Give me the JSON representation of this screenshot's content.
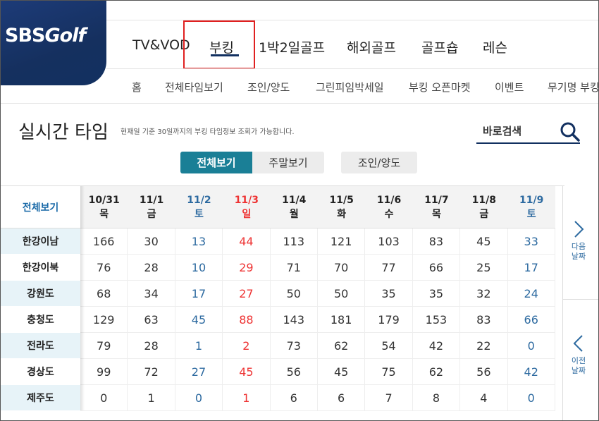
{
  "logo": {
    "sbs": "SBS",
    "golf": "Golf"
  },
  "main_nav": [
    {
      "label": "TV&VOD"
    },
    {
      "label": "부킹"
    },
    {
      "label": "1박2일골프"
    },
    {
      "label": "해외골프"
    },
    {
      "label": "골프숍"
    },
    {
      "label": "레슨"
    }
  ],
  "sub_nav": [
    {
      "label": "홈"
    },
    {
      "label": "전체타임보기"
    },
    {
      "label": "조인/양도"
    },
    {
      "label": "그린피임박세일"
    },
    {
      "label": "부킹 오픈마켓"
    },
    {
      "label": "이벤트"
    },
    {
      "label": "무기명 부킹"
    }
  ],
  "page": {
    "title": "실시간 타임",
    "description": "현재일 기준 30일까지의 부킹 타임정보 조회가 가능합니다."
  },
  "search": {
    "label": "바로검색",
    "icon": "search-icon"
  },
  "tabs": {
    "all": "전체보기",
    "weekend": "주말보기",
    "join": "조인/양도"
  },
  "table": {
    "corner_label": "전체보기",
    "dates": [
      {
        "date": "10/31",
        "day": "목",
        "type": "weekday"
      },
      {
        "date": "11/1",
        "day": "금",
        "type": "weekday"
      },
      {
        "date": "11/2",
        "day": "토",
        "type": "sat"
      },
      {
        "date": "11/3",
        "day": "일",
        "type": "sun"
      },
      {
        "date": "11/4",
        "day": "월",
        "type": "weekday"
      },
      {
        "date": "11/5",
        "day": "화",
        "type": "weekday"
      },
      {
        "date": "11/6",
        "day": "수",
        "type": "weekday"
      },
      {
        "date": "11/7",
        "day": "목",
        "type": "weekday"
      },
      {
        "date": "11/8",
        "day": "금",
        "type": "weekday"
      },
      {
        "date": "11/9",
        "day": "토",
        "type": "sat"
      }
    ],
    "rows": [
      {
        "region": "한강이남",
        "values": [
          166,
          30,
          13,
          44,
          113,
          121,
          103,
          83,
          45,
          33
        ]
      },
      {
        "region": "한강이북",
        "values": [
          76,
          28,
          10,
          29,
          71,
          70,
          77,
          66,
          25,
          17
        ]
      },
      {
        "region": "강원도",
        "values": [
          68,
          34,
          17,
          27,
          50,
          50,
          35,
          35,
          32,
          24
        ]
      },
      {
        "region": "충청도",
        "values": [
          129,
          63,
          45,
          88,
          143,
          181,
          179,
          153,
          83,
          66
        ]
      },
      {
        "region": "전라도",
        "values": [
          79,
          28,
          1,
          2,
          73,
          62,
          54,
          42,
          22,
          0
        ]
      },
      {
        "region": "경상도",
        "values": [
          99,
          72,
          27,
          45,
          56,
          45,
          75,
          62,
          56,
          42
        ]
      },
      {
        "region": "제주도",
        "values": [
          0,
          1,
          0,
          1,
          6,
          6,
          7,
          8,
          4,
          0
        ]
      }
    ]
  },
  "pager": {
    "next_line1": "다음",
    "next_line2": "날짜",
    "prev_line1": "이전",
    "prev_line2": "날짜"
  },
  "colors": {
    "brand": "#123060",
    "accent": "#1a7f96",
    "saturday": "#2d6aa0",
    "sunday": "#e33333",
    "highlight": "#e02020"
  }
}
